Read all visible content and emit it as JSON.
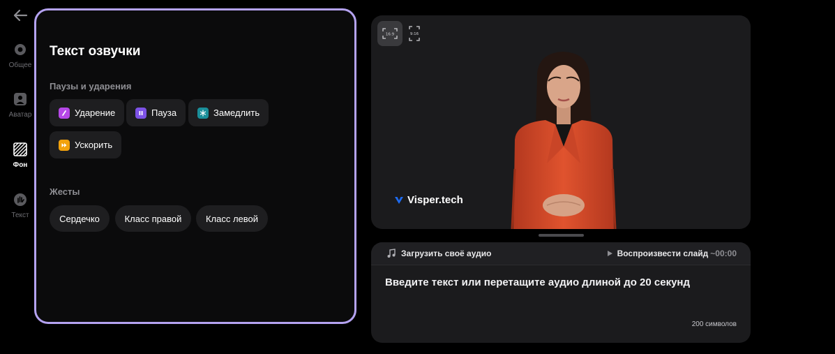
{
  "sidebar": {
    "back_icon": "arrow-left-icon",
    "items": [
      {
        "label": "Общее",
        "icon": "gear-icon"
      },
      {
        "label": "Аватар",
        "icon": "person-icon"
      },
      {
        "label": "Фон",
        "icon": "background-icon",
        "active": true
      },
      {
        "label": "Текст",
        "icon": "hand-icon"
      }
    ]
  },
  "panel": {
    "title": "Текст озвучки",
    "pauses_label": "Паузы и ударения",
    "pauses": [
      {
        "label": "Ударение",
        "icon": "stress-icon",
        "color": "#b648e8"
      },
      {
        "label": "Пауза",
        "icon": "pause-icon",
        "color": "#7d52e6"
      },
      {
        "label": "Замедлить",
        "icon": "snowflake-icon",
        "color": "#1a8f9a"
      },
      {
        "label": "Ускорить",
        "icon": "fast-forward-icon",
        "color": "#f2a20c"
      }
    ],
    "gestures_label": "Жесты",
    "gestures": [
      "Сердечко",
      "Класс правой",
      "Класс левой"
    ]
  },
  "preview": {
    "ratio_options": [
      "16:9",
      "9:16"
    ],
    "selected_ratio": "16:9",
    "brand": "Visper.tech"
  },
  "script": {
    "upload_label": "Загрузить своё аудио",
    "play_label": "Воспроизвести слайд",
    "duration": "~00:00",
    "placeholder": "Введите текст или перетащите аудио длиной до 20 секунд",
    "counter": "200 символов"
  },
  "colors": {
    "accent_border": "#b4a2f0",
    "panel_bg": "#0b0b0c",
    "chip_bg": "#1e1e20",
    "brand_blue": "#1e6bf0"
  }
}
